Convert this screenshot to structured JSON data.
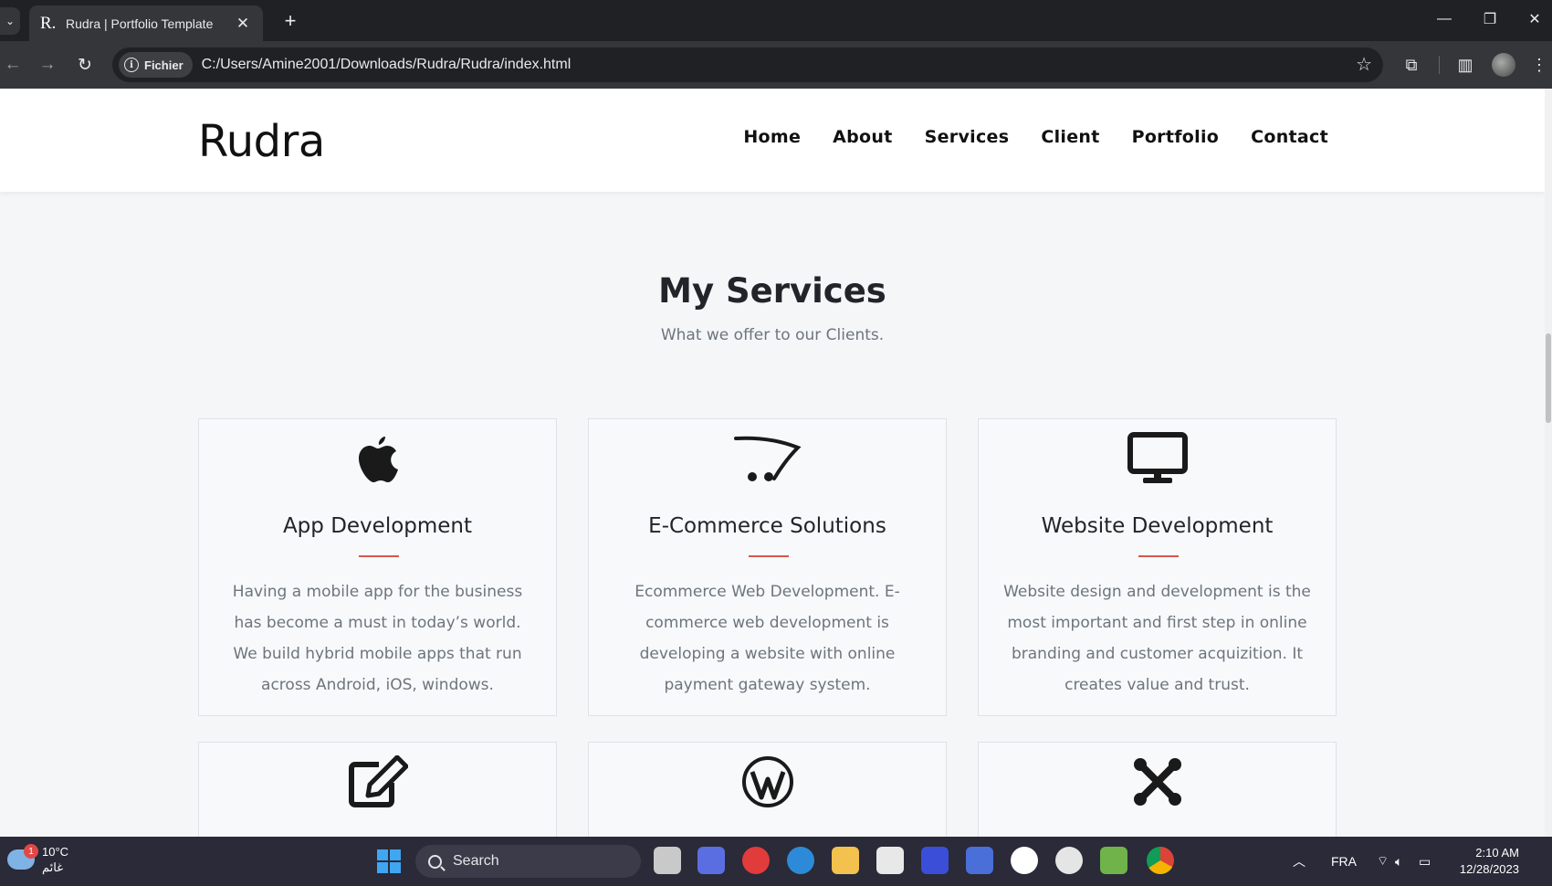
{
  "browser": {
    "tab_title": "Rudra | Portfolio Template",
    "tab_favicon": "R.",
    "security_chip": "Fichier",
    "url": "C:/Users/Amine2001/Downloads/Rudra/Rudra/index.html"
  },
  "site": {
    "brand": "Rudra",
    "nav": [
      "Home",
      "About",
      "Services",
      "Client",
      "Portfolio",
      "Contact"
    ]
  },
  "services": {
    "title": "My Services",
    "subtitle": "What we offer to our Clients.",
    "accent_color": "#d6564f",
    "cards": [
      {
        "icon": "apple-icon",
        "name": "App Development",
        "desc": "Having a mobile app for the business has become a must in today’s world. We build hybrid mobile apps that run across Android, iOS, windows."
      },
      {
        "icon": "cart-icon",
        "name": "E-Commerce Solutions",
        "desc": "Ecommerce Web Development. E-commerce web development is developing a website with online payment gateway system."
      },
      {
        "icon": "desktop-icon",
        "name": "Website Development",
        "desc": "Website design and development is the most important and first step in online branding and customer acquizition. It creates value and trust."
      },
      {
        "icon": "edit-icon"
      },
      {
        "icon": "wordpress-icon"
      },
      {
        "icon": "joomla-icon"
      }
    ]
  },
  "taskbar": {
    "weather_temp": "10°C",
    "weather_label": "غائم",
    "weather_badge": "1",
    "search_placeholder": "Search",
    "language": "FRA",
    "time": "2:10 AM",
    "date": "12/28/2023"
  }
}
